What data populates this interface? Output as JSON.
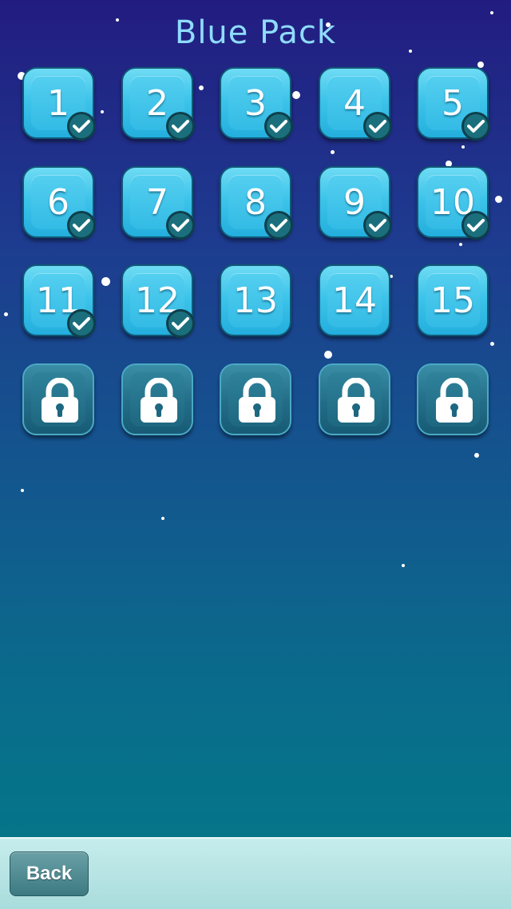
{
  "title": "Blue Pack",
  "levels": [
    {
      "label": "1",
      "completed": true
    },
    {
      "label": "2",
      "completed": true
    },
    {
      "label": "3",
      "completed": true
    },
    {
      "label": "4",
      "completed": true
    },
    {
      "label": "5",
      "completed": true
    },
    {
      "label": "6",
      "completed": true
    },
    {
      "label": "7",
      "completed": true
    },
    {
      "label": "8",
      "completed": true
    },
    {
      "label": "9",
      "completed": true
    },
    {
      "label": "10",
      "completed": true
    },
    {
      "label": "11",
      "completed": true
    },
    {
      "label": "12",
      "completed": true
    },
    {
      "label": "13",
      "completed": false
    },
    {
      "label": "14",
      "completed": false
    },
    {
      "label": "15",
      "completed": false
    }
  ],
  "locked_level_count": 5,
  "back_label": "Back",
  "icons": {
    "completed": "checkmark-icon",
    "locked": "padlock-icon"
  },
  "colors": {
    "title": "#8fdcff",
    "tile": "#3ec4ea",
    "check_badge": "#1b6f7d"
  }
}
